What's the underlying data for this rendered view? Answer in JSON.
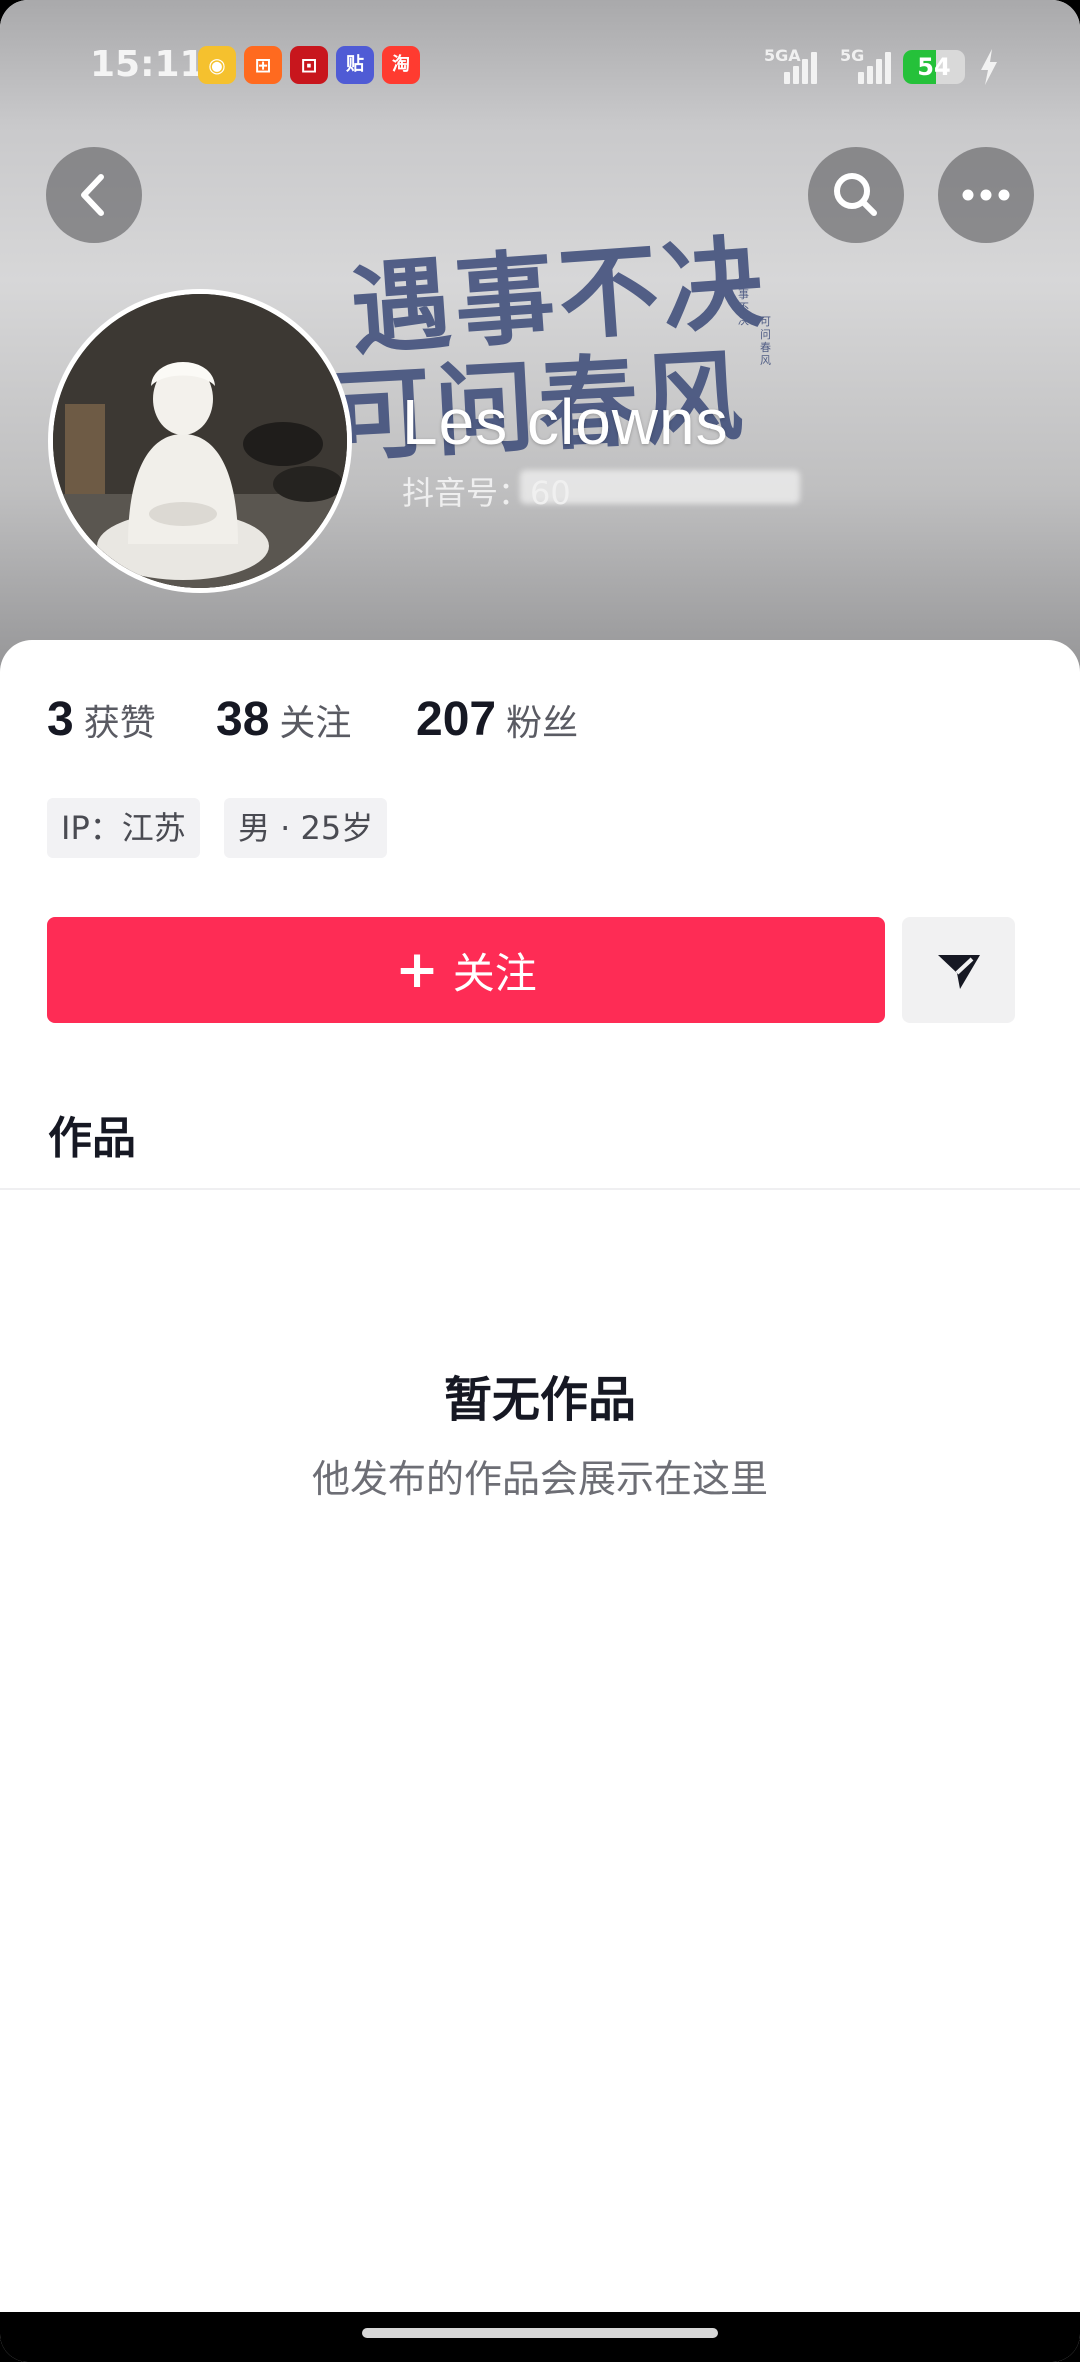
{
  "status_bar": {
    "time": "15:11",
    "apps": [
      {
        "icon": "weibo-icon",
        "glyph": "◉",
        "color": "#f5a623"
      },
      {
        "icon": "kuaishou-icon",
        "glyph": "⊞",
        "color": "#ff5a1f"
      },
      {
        "icon": "bank-icon",
        "glyph": "⊡",
        "color": "#c8161d"
      },
      {
        "icon": "tieba-icon",
        "glyph": "贴",
        "color": "#3d5afe"
      },
      {
        "icon": "taobao-icon",
        "glyph": "淘",
        "color": "#ff2a2a"
      }
    ],
    "network_1": "5GA",
    "network_2": "5G",
    "battery": "54",
    "battery_level": 0.54,
    "battery_color": "#25c13a"
  },
  "header": {
    "back_icon": "chevron-left-icon",
    "search_icon": "search-icon",
    "more_icon": "more-icon",
    "banner_text_line1": "遇事不决",
    "banner_text_line2": "可问春风",
    "banner_side_left": "行事不决",
    "banner_side_right": "可问春风"
  },
  "profile": {
    "nickname": "Les clowns",
    "douyin_id_label": "抖音号：",
    "douyin_id_value": "60"
  },
  "stats": [
    {
      "value": "3",
      "label": "获赞"
    },
    {
      "value": "38",
      "label": "关注"
    },
    {
      "value": "207",
      "label": "粉丝"
    }
  ],
  "tags": [
    "IP：江苏",
    "男 · 25岁"
  ],
  "actions": {
    "follow_label": "关注",
    "follow_color": "#fe2c55",
    "share_icon": "send-icon"
  },
  "tabs": {
    "works_label": "作品"
  },
  "empty_state": {
    "title": "暂无作品",
    "subtitle": "他发布的作品会展示在这里"
  }
}
